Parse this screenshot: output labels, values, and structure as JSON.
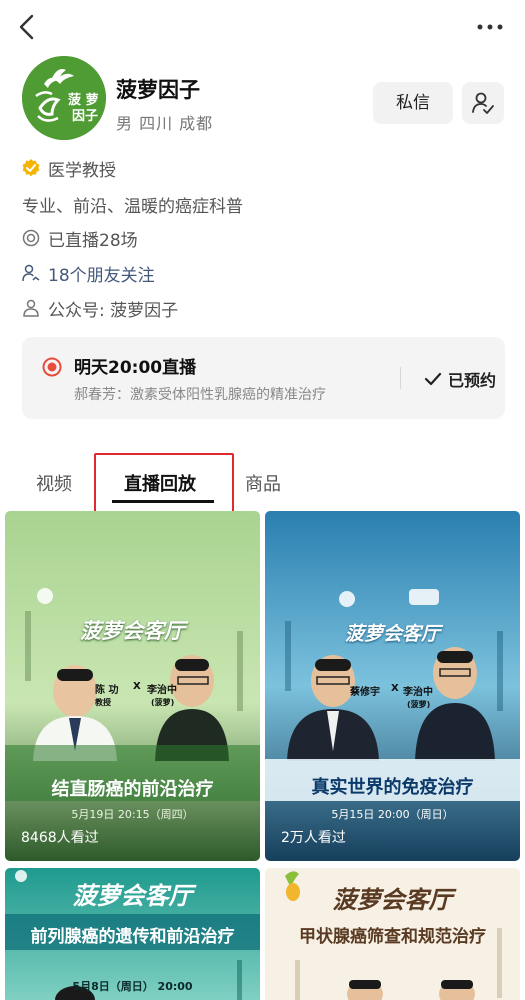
{
  "profile": {
    "name": "菠萝因子",
    "meta": "男 四川 成都",
    "avatar_text": "菠萝\n因子",
    "message_button": "私信",
    "verify_label": "医学教授",
    "description": "专业、前沿、温暖的癌症科普",
    "live_count": "已直播28场",
    "friends": "18个朋友关注",
    "official_account": "公众号: 菠萝因子"
  },
  "live_reminder": {
    "title": "明天20:00直播",
    "subtitle": "郝春芳：激素受体阳性乳腺癌的精准治疗",
    "status": "已预约"
  },
  "tabs": [
    {
      "label": "视频",
      "active": false
    },
    {
      "label": "直播回放",
      "active": true
    },
    {
      "label": "商品",
      "active": false
    }
  ],
  "videos": [
    {
      "brand": "菠萝会客厅",
      "guest_a": "陈 功",
      "guest_a_role": "教授",
      "x": "X",
      "guest_b": "李治中",
      "guest_b_role": "(菠萝)",
      "title": "结直肠癌的前沿治疗",
      "date": "5月19日 20:15（周四）",
      "views": "8468人看过"
    },
    {
      "brand": "菠萝会客厅",
      "guest_a": "蔡修宇",
      "x": "X",
      "guest_b": "李治中",
      "guest_b_role": "(菠萝)",
      "title": "真实世界的免疫治疗",
      "date": "5月15日 20:00（周日）",
      "views": "2万人看过"
    },
    {
      "brand": "菠萝会客厅",
      "title": "前列腺癌的遗传和前沿治疗",
      "date": "5月8日（周日） 20:00"
    },
    {
      "brand": "菠萝会客厅",
      "title": "甲状腺癌筛查和规范治疗"
    }
  ],
  "colors": {
    "accent": "#e0282e",
    "verify": "#f5b400",
    "link": "#44597c",
    "live": "#e84c3d"
  }
}
